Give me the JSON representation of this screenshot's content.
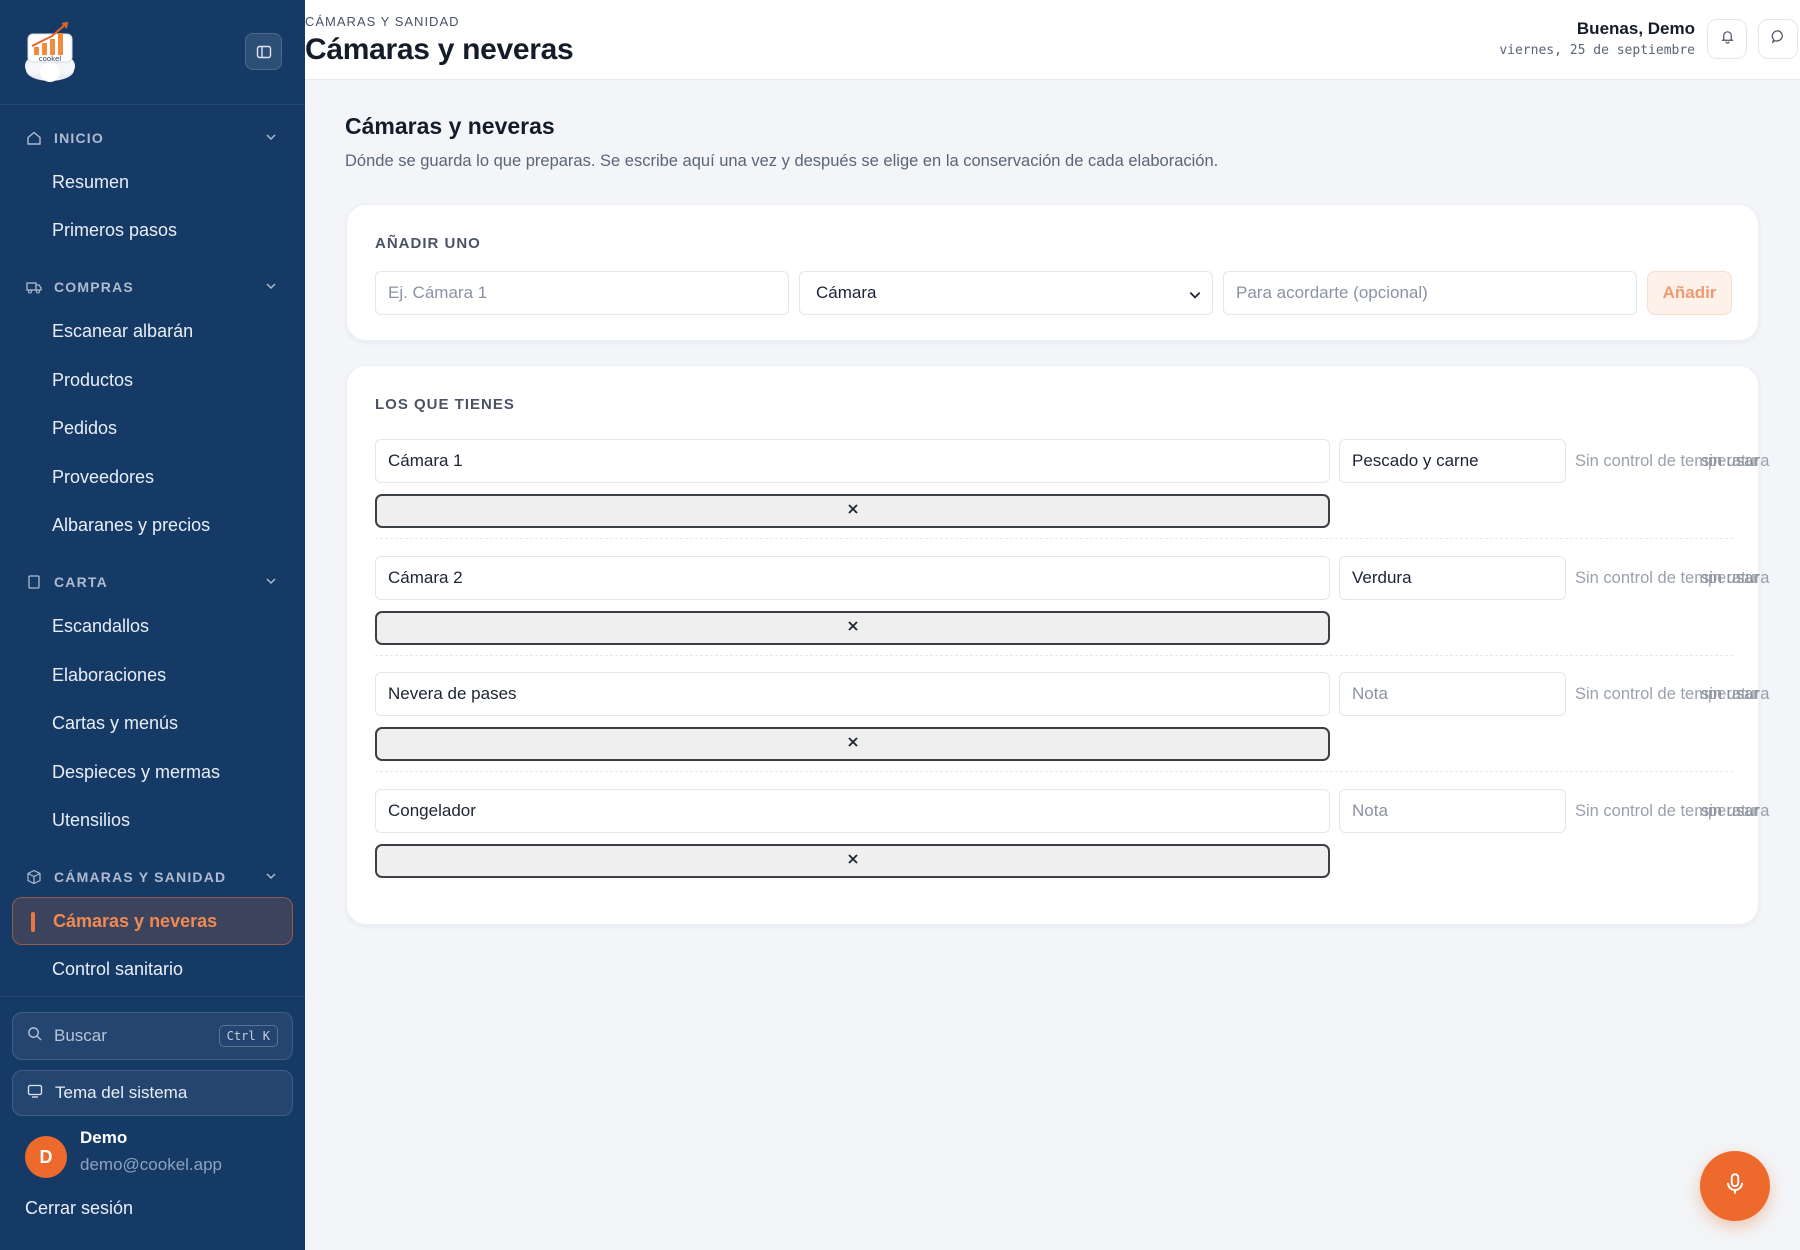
{
  "brand": {
    "logo_text": "cookel"
  },
  "sidebar": {
    "sections": [
      {
        "label": "INICIO",
        "icon": "home-icon",
        "items": [
          "Resumen",
          "Primeros pasos"
        ]
      },
      {
        "label": "COMPRAS",
        "icon": "truck-icon",
        "items": [
          "Escanear albarán",
          "Productos",
          "Pedidos",
          "Proveedores",
          "Albaranes y precios"
        ]
      },
      {
        "label": "CARTA",
        "icon": "book-icon",
        "items": [
          "Escandallos",
          "Elaboraciones",
          "Cartas y menús",
          "Despieces y mermas",
          "Utensilios"
        ]
      },
      {
        "label": "CÁMARAS Y SANIDAD",
        "icon": "box-icon",
        "items": [
          "Cámaras y neveras",
          "Control sanitario"
        ]
      }
    ],
    "active_item": "Cámaras y neveras",
    "search": {
      "label": "Buscar",
      "shortcut": "Ctrl K"
    },
    "theme_label": "Tema del sistema",
    "user": {
      "initial": "D",
      "name": "Demo",
      "email": "demo@cookel.app"
    },
    "logout_label": "Cerrar sesión"
  },
  "header": {
    "breadcrumb": "CÁMARAS Y SANIDAD",
    "title": "Cámaras y neveras",
    "greeting": "Buenas, Demo",
    "date": "viernes, 25 de septiembre"
  },
  "main": {
    "title": "Cámaras y neveras",
    "description": "Dónde se guarda lo que preparas. Se escribe aquí una vez y después se elige en la conservación de cada elaboración.",
    "add_card": {
      "label": "AÑADIR UNO",
      "name_placeholder": "Ej. Cámara 1",
      "type_selected": "Cámara",
      "note_placeholder": "Para acordarte (opcional)",
      "add_button": "Añadir"
    },
    "list_card": {
      "label": "LOS QUE TIENES",
      "note_placeholder": "Nota",
      "temp_text": "Sin control de temperatura",
      "temp_overlay": "sin usar",
      "delete_symbol": "×",
      "rows": [
        {
          "name": "Cámara 1",
          "note": "Pescado y carne"
        },
        {
          "name": "Cámara 2",
          "note": "Verdura"
        },
        {
          "name": "Nevera de pases",
          "note": ""
        },
        {
          "name": "Congelador",
          "note": ""
        }
      ]
    }
  },
  "colors": {
    "sidebar_bg": "#163a66",
    "accent": "#ee6a2c",
    "page_bg": "#f3f5f8"
  }
}
